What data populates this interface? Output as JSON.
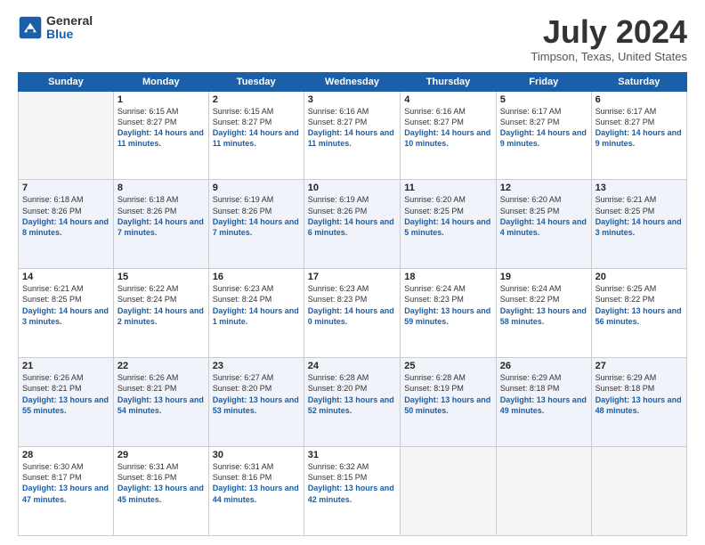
{
  "logo": {
    "general": "General",
    "blue": "Blue"
  },
  "header": {
    "month": "July 2024",
    "location": "Timpson, Texas, United States"
  },
  "weekdays": [
    "Sunday",
    "Monday",
    "Tuesday",
    "Wednesday",
    "Thursday",
    "Friday",
    "Saturday"
  ],
  "weeks": [
    [
      {
        "day": "",
        "empty": true
      },
      {
        "day": "1",
        "sunrise": "6:15 AM",
        "sunset": "8:27 PM",
        "daylight": "14 hours and 11 minutes."
      },
      {
        "day": "2",
        "sunrise": "6:15 AM",
        "sunset": "8:27 PM",
        "daylight": "14 hours and 11 minutes."
      },
      {
        "day": "3",
        "sunrise": "6:16 AM",
        "sunset": "8:27 PM",
        "daylight": "14 hours and 11 minutes."
      },
      {
        "day": "4",
        "sunrise": "6:16 AM",
        "sunset": "8:27 PM",
        "daylight": "14 hours and 10 minutes."
      },
      {
        "day": "5",
        "sunrise": "6:17 AM",
        "sunset": "8:27 PM",
        "daylight": "14 hours and 9 minutes."
      },
      {
        "day": "6",
        "sunrise": "6:17 AM",
        "sunset": "8:27 PM",
        "daylight": "14 hours and 9 minutes."
      }
    ],
    [
      {
        "day": "7",
        "sunrise": "6:18 AM",
        "sunset": "8:26 PM",
        "daylight": "14 hours and 8 minutes."
      },
      {
        "day": "8",
        "sunrise": "6:18 AM",
        "sunset": "8:26 PM",
        "daylight": "14 hours and 7 minutes."
      },
      {
        "day": "9",
        "sunrise": "6:19 AM",
        "sunset": "8:26 PM",
        "daylight": "14 hours and 7 minutes."
      },
      {
        "day": "10",
        "sunrise": "6:19 AM",
        "sunset": "8:26 PM",
        "daylight": "14 hours and 6 minutes."
      },
      {
        "day": "11",
        "sunrise": "6:20 AM",
        "sunset": "8:25 PM",
        "daylight": "14 hours and 5 minutes."
      },
      {
        "day": "12",
        "sunrise": "6:20 AM",
        "sunset": "8:25 PM",
        "daylight": "14 hours and 4 minutes."
      },
      {
        "day": "13",
        "sunrise": "6:21 AM",
        "sunset": "8:25 PM",
        "daylight": "14 hours and 3 minutes."
      }
    ],
    [
      {
        "day": "14",
        "sunrise": "6:21 AM",
        "sunset": "8:25 PM",
        "daylight": "14 hours and 3 minutes."
      },
      {
        "day": "15",
        "sunrise": "6:22 AM",
        "sunset": "8:24 PM",
        "daylight": "14 hours and 2 minutes."
      },
      {
        "day": "16",
        "sunrise": "6:23 AM",
        "sunset": "8:24 PM",
        "daylight": "14 hours and 1 minute."
      },
      {
        "day": "17",
        "sunrise": "6:23 AM",
        "sunset": "8:23 PM",
        "daylight": "14 hours and 0 minutes."
      },
      {
        "day": "18",
        "sunrise": "6:24 AM",
        "sunset": "8:23 PM",
        "daylight": "13 hours and 59 minutes."
      },
      {
        "day": "19",
        "sunrise": "6:24 AM",
        "sunset": "8:22 PM",
        "daylight": "13 hours and 58 minutes."
      },
      {
        "day": "20",
        "sunrise": "6:25 AM",
        "sunset": "8:22 PM",
        "daylight": "13 hours and 56 minutes."
      }
    ],
    [
      {
        "day": "21",
        "sunrise": "6:26 AM",
        "sunset": "8:21 PM",
        "daylight": "13 hours and 55 minutes."
      },
      {
        "day": "22",
        "sunrise": "6:26 AM",
        "sunset": "8:21 PM",
        "daylight": "13 hours and 54 minutes."
      },
      {
        "day": "23",
        "sunrise": "6:27 AM",
        "sunset": "8:20 PM",
        "daylight": "13 hours and 53 minutes."
      },
      {
        "day": "24",
        "sunrise": "6:28 AM",
        "sunset": "8:20 PM",
        "daylight": "13 hours and 52 minutes."
      },
      {
        "day": "25",
        "sunrise": "6:28 AM",
        "sunset": "8:19 PM",
        "daylight": "13 hours and 50 minutes."
      },
      {
        "day": "26",
        "sunrise": "6:29 AM",
        "sunset": "8:18 PM",
        "daylight": "13 hours and 49 minutes."
      },
      {
        "day": "27",
        "sunrise": "6:29 AM",
        "sunset": "8:18 PM",
        "daylight": "13 hours and 48 minutes."
      }
    ],
    [
      {
        "day": "28",
        "sunrise": "6:30 AM",
        "sunset": "8:17 PM",
        "daylight": "13 hours and 47 minutes."
      },
      {
        "day": "29",
        "sunrise": "6:31 AM",
        "sunset": "8:16 PM",
        "daylight": "13 hours and 45 minutes."
      },
      {
        "day": "30",
        "sunrise": "6:31 AM",
        "sunset": "8:16 PM",
        "daylight": "13 hours and 44 minutes."
      },
      {
        "day": "31",
        "sunrise": "6:32 AM",
        "sunset": "8:15 PM",
        "daylight": "13 hours and 42 minutes."
      },
      {
        "day": "",
        "empty": true
      },
      {
        "day": "",
        "empty": true
      },
      {
        "day": "",
        "empty": true
      }
    ]
  ]
}
